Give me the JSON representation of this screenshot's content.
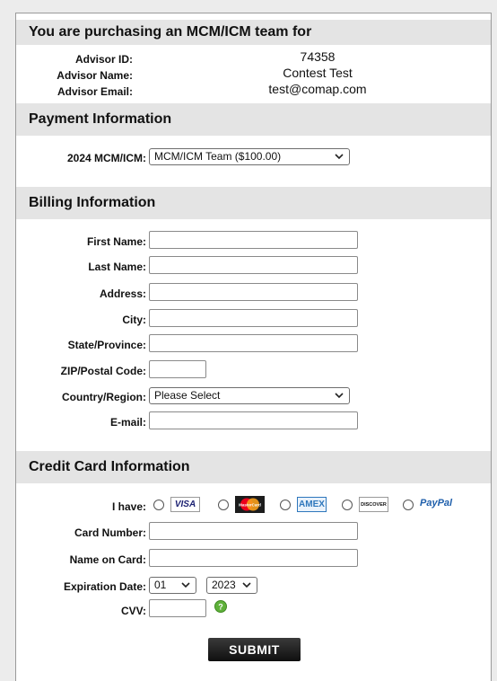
{
  "purchase_header": "You are purchasing an MCM/ICM team for",
  "advisor": {
    "id_label": "Advisor ID:",
    "id_value": "74358",
    "name_label": "Advisor Name:",
    "name_value": "Contest Test",
    "email_label": "Advisor Email:",
    "email_value": "test@comap.com"
  },
  "payment": {
    "title": "Payment Information",
    "product_label": "2024 MCM/ICM:",
    "product_selected": "MCM/ICM Team ($100.00)"
  },
  "billing": {
    "title": "Billing Information",
    "first_name_label": "First Name:",
    "last_name_label": "Last Name:",
    "address_label": "Address:",
    "city_label": "City:",
    "state_label": "State/Province:",
    "zip_label": "ZIP/Postal Code:",
    "country_label": "Country/Region:",
    "country_selected": "Please Select",
    "email_label": "E-mail:"
  },
  "credit": {
    "title": "Credit Card Information",
    "have_label": "I have:",
    "cards": [
      "VISA",
      "MasterCard",
      "AMEX",
      "DISCOVER",
      "PayPal"
    ],
    "card_number_label": "Card Number:",
    "name_on_card_label": "Name on Card:",
    "expiration_label": "Expiration Date:",
    "exp_month": "01",
    "exp_year": "2023",
    "cvv_label": "CVV:"
  },
  "submit_label": "SUBMIT",
  "colors": {
    "section_bg": "#e4e4e4",
    "visa_blue": "#1a1f71",
    "mc_red": "#eb001b",
    "mc_orange": "#f79e1b",
    "amex_blue": "#2e77bc",
    "discover_orange": "#f58220",
    "paypal_blue": "#1f5fab",
    "help_green": "#5fb13a"
  }
}
